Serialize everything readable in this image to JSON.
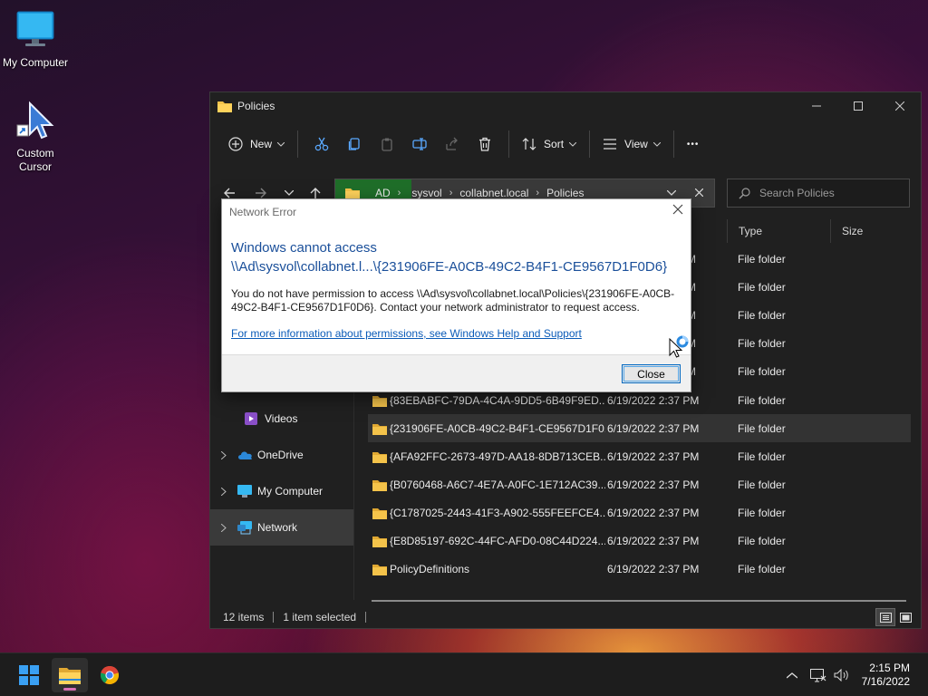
{
  "desktop": {
    "icons": [
      {
        "label": "My Computer"
      },
      {
        "label": "Custom Cursor"
      }
    ]
  },
  "explorer": {
    "title": "Policies",
    "toolbar": {
      "new_label": "New",
      "sort_label": "Sort",
      "view_label": "View",
      "more_label": "•••"
    },
    "address": {
      "crumbs": [
        "AD",
        "sysvol",
        "collabnet.local",
        "Policies"
      ]
    },
    "search": {
      "placeholder": "Search Policies"
    },
    "sidebar": {
      "items": [
        {
          "label": "Videos"
        },
        {
          "label": "OneDrive"
        },
        {
          "label": "My Computer"
        },
        {
          "label": "Network"
        }
      ]
    },
    "columns": {
      "type": "Type",
      "size": "Size"
    },
    "partial_rows": [
      "M",
      "M",
      "M",
      "M",
      "M"
    ],
    "rows": [
      {
        "name": "{83EBABFC-79DA-4C4A-9DD5-6B49F9ED...",
        "date": "6/19/2022 2:37 PM",
        "type": "File folder",
        "selected": false
      },
      {
        "name": "{231906FE-A0CB-49C2-B4F1-CE9567D1F0...",
        "date": "6/19/2022 2:37 PM",
        "type": "File folder",
        "selected": true
      },
      {
        "name": "{AFA92FFC-2673-497D-AA18-8DB713CEB...",
        "date": "6/19/2022 2:37 PM",
        "type": "File folder",
        "selected": false
      },
      {
        "name": "{B0760468-A6C7-4E7A-A0FC-1E712AC39...",
        "date": "6/19/2022 2:37 PM",
        "type": "File folder",
        "selected": false
      },
      {
        "name": "{C1787025-2443-41F3-A902-555FEEFCE4...",
        "date": "6/19/2022 2:37 PM",
        "type": "File folder",
        "selected": false
      },
      {
        "name": "{E8D85197-692C-44FC-AFD0-08C44D224...",
        "date": "6/19/2022 2:37 PM",
        "type": "File folder",
        "selected": false
      },
      {
        "name": "PolicyDefinitions",
        "date": "6/19/2022 2:37 PM",
        "type": "File folder",
        "selected": false
      }
    ],
    "upper_types": [
      "File folder",
      "File folder",
      "File folder",
      "File folder",
      "File folder"
    ],
    "status": {
      "items": "12 items",
      "selected": "1 item selected"
    }
  },
  "dialog": {
    "title": "Network Error",
    "heading_line1": "Windows cannot access",
    "heading_line2": "\\\\Ad\\sysvol\\collabnet.l...\\{231906FE-A0CB-49C2-B4F1-CE9567D1F0D6}",
    "body": "You do not have permission to access \\\\Ad\\sysvol\\collabnet.local\\Policies\\{231906FE-A0CB-49C2-B4F1-CE9567D1F0D6}. Contact your network administrator to request access.",
    "link": "For more information about permissions, see Windows Help and Support",
    "close_button": "Close"
  },
  "taskbar": {
    "time": "2:15 PM",
    "date": "7/16/2022"
  },
  "colors": {
    "accent": "#0067c0",
    "address_highlight": "#1f6e29",
    "dialog_heading": "#1a4f9a",
    "link": "#0a5bb8",
    "folder": "#f4c34a"
  }
}
